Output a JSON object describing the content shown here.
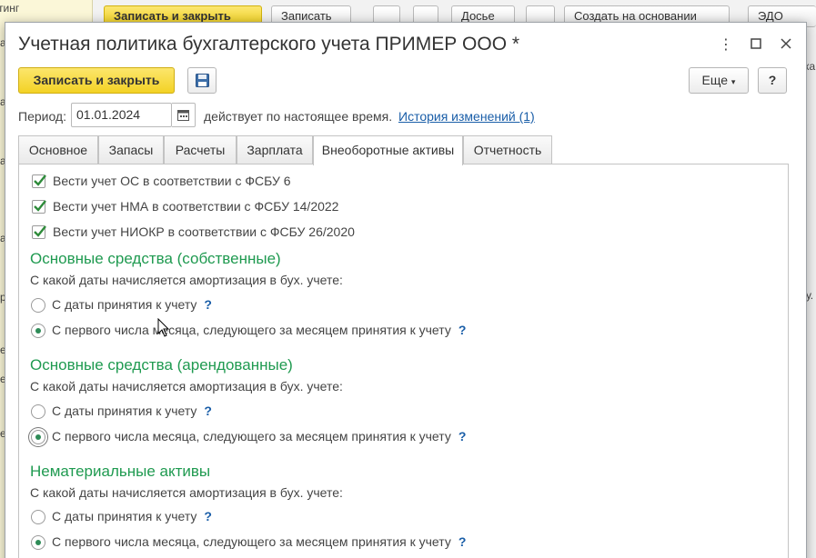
{
  "background": {
    "toolbar": {
      "save_close": "Записать и закрыть",
      "save": "Записать",
      "dossier": "Досье",
      "create_based_on": "Создать на основании",
      "edo": "ЭДО"
    },
    "left_fragments": [
      "тинг",
      "а",
      "а",
      "а",
      "а",
      "р",
      "е",
      "е",
      "е"
    ],
    "right_fragments": [
      "ка",
      "у."
    ]
  },
  "dialog": {
    "title": "Учетная политика бухгалтерского учета ПРИМЕР ООО *",
    "toolbar": {
      "save_close": "Записать и закрыть",
      "more": "Еще",
      "help": "?"
    },
    "period": {
      "label": "Период:",
      "value": "01.01.2024",
      "note": "действует по настоящее время.",
      "history_link": "История изменений (1)"
    },
    "tabs": [
      "Основное",
      "Запасы",
      "Расчеты",
      "Зарплата",
      "Внеоборотные активы",
      "Отчетность"
    ],
    "active_tab": "Внеоборотные активы",
    "checkboxes": [
      {
        "label": "Вести учет ОС в соответствии с ФСБУ 6",
        "checked": true
      },
      {
        "label": "Вести учет НМА в соответствии с ФСБУ 14/2022",
        "checked": true
      },
      {
        "label": "Вести учет НИОКР в соответствии с ФСБУ 26/2020",
        "checked": true
      }
    ],
    "sections": [
      {
        "title": "Основные средства (собственные)",
        "question": "С какой даты начисляется амортизация в бух. учете:",
        "options": [
          {
            "label": "С даты принятия к учету",
            "selected": false
          },
          {
            "label": "С первого числа месяца, следующего за месяцем принятия к учету",
            "selected": true
          }
        ]
      },
      {
        "title": "Основные средства (арендованные)",
        "question": "С какой даты начисляется амортизация в бух. учете:",
        "options": [
          {
            "label": "С даты принятия к учету",
            "selected": false
          },
          {
            "label": "С первого числа месяца, следующего за месяцем принятия к учету",
            "selected": true
          }
        ]
      },
      {
        "title": "Нематериальные активы",
        "question": "С какой даты начисляется амортизация в бух. учете:",
        "options": [
          {
            "label": "С даты принятия к учету",
            "selected": false
          },
          {
            "label": "С первого числа месяца, следующего за месяцем принятия к учету",
            "selected": true
          }
        ]
      }
    ],
    "help_mark": "?"
  }
}
